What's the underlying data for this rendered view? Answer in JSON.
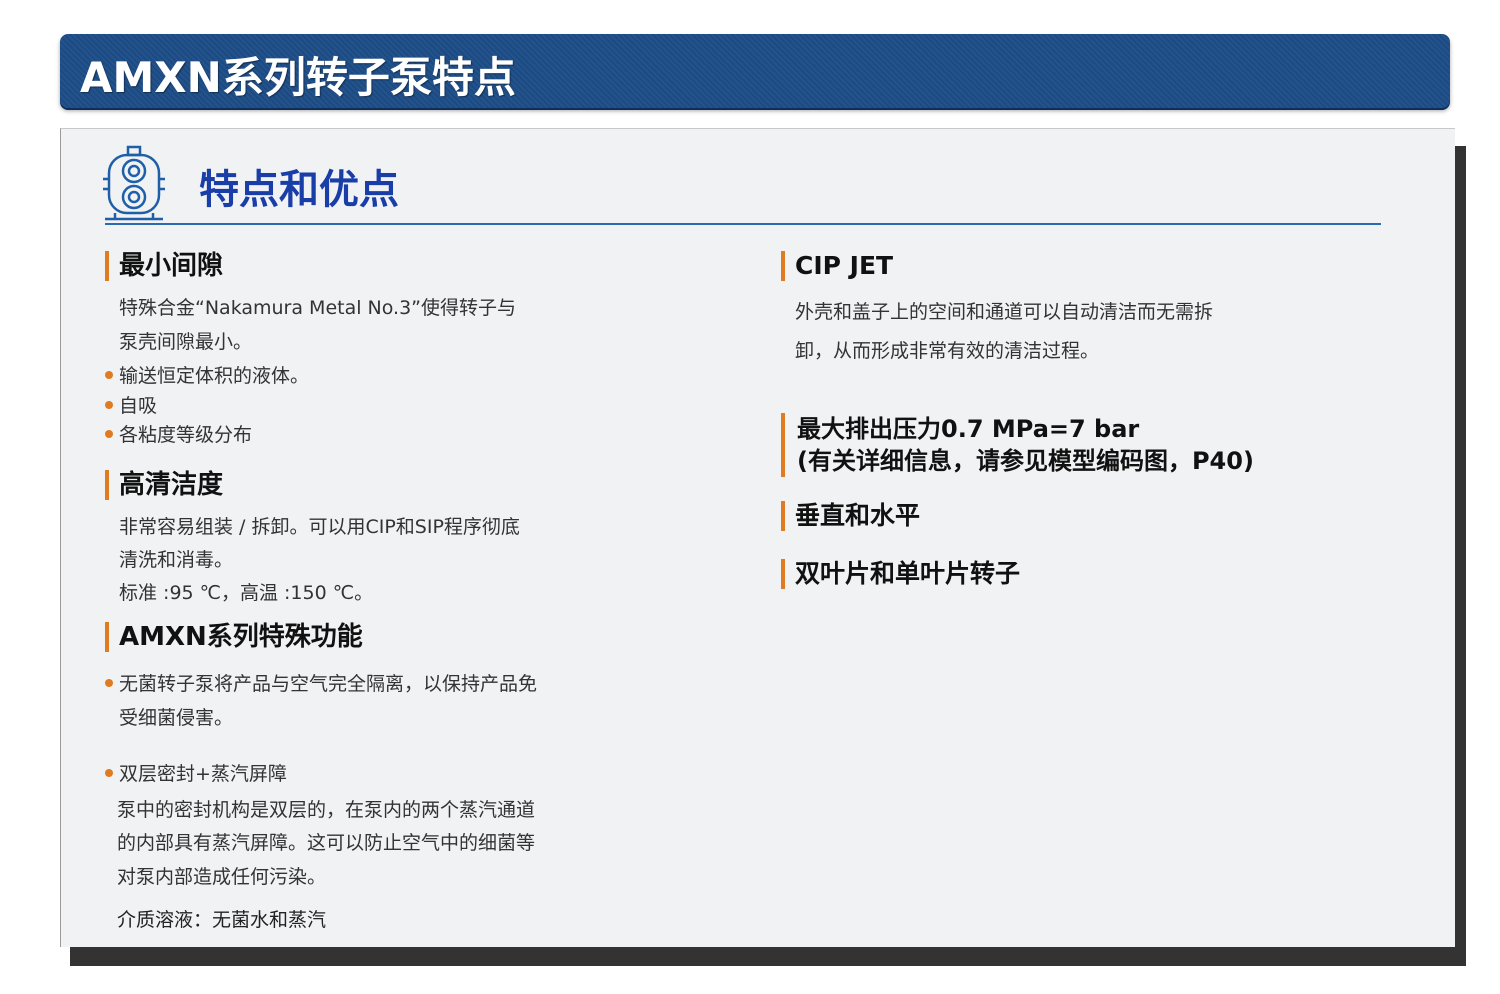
{
  "banner": {
    "title": "AMXN系列转子泵特点"
  },
  "section": {
    "title": "特点和优点",
    "icon": "rotary-pump-icon"
  },
  "left": {
    "min_clearance": {
      "heading": "最小间隙",
      "line1": "特殊合金“Nakamura Metal No.3”使得转子与",
      "line2": "泵壳间隙最小。",
      "bullets": [
        "输送恒定体积的液体。",
        "自吸",
        "各粘度等级分布"
      ]
    },
    "cleanliness": {
      "heading": "高清洁度",
      "line1": "非常容易组装 / 拆卸。可以用CIP和SIP程序彻底",
      "line2": "清洗和消毒。",
      "line3": "标准 :95 ℃，高温 :150 ℃。"
    },
    "special": {
      "heading": "AMXN系列特殊功能",
      "bullet1_line1": "无菌转子泵将产品与空气完全隔离，以保持产品免",
      "bullet1_line2": "受细菌侵害。",
      "bullet2": "双层密封+蒸汽屏障",
      "line1": "泵中的密封机构是双层的，在泵内的两个蒸汽通道",
      "line2": "的内部具有蒸汽屏障。这可以防止空气中的细菌等",
      "line3": "对泵内部造成任何污染。",
      "media": "介质溶液：无菌水和蒸汽"
    }
  },
  "right": {
    "cip": {
      "heading": "CIP JET",
      "line1": "外壳和盖子上的空间和通道可以自动清洁而无需拆",
      "line2": "卸，从而形成非常有效的清洁过程。"
    },
    "pressure": {
      "line1": "最大排出压力0.7 MPa=7 bar",
      "line2": "(有关详细信息，请参见模型编码图，P40)"
    },
    "orientation": {
      "heading": "垂直和水平"
    },
    "rotor": {
      "heading": "双叶片和单叶片转子"
    }
  },
  "colors": {
    "banner": "#1d4c86",
    "accent": "#e07b22",
    "title_blue": "#1a3ea8"
  }
}
